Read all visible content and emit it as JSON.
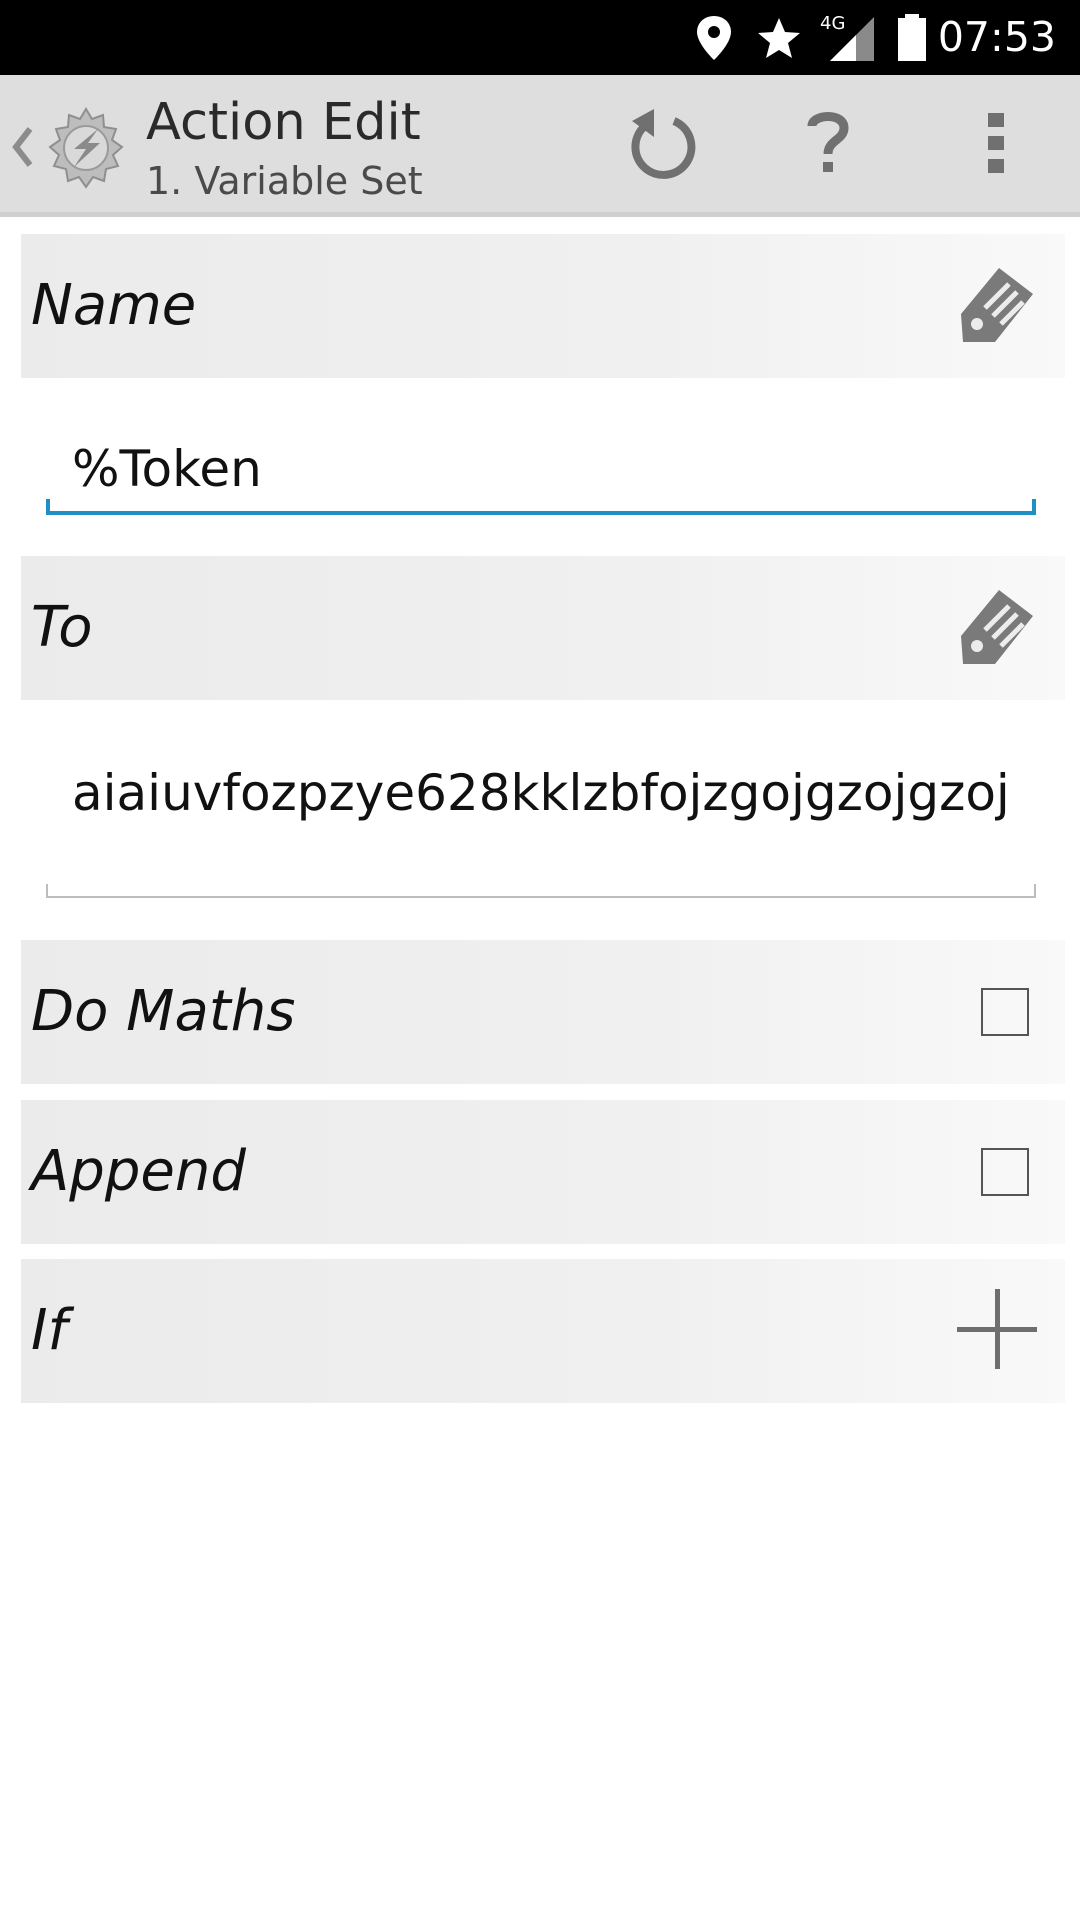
{
  "status_bar": {
    "network": "4G",
    "time": "07:53",
    "icons": [
      "location-icon",
      "star-icon",
      "signal-icon",
      "battery-icon"
    ]
  },
  "action_bar": {
    "title": "Action Edit",
    "subtitle": "1. Variable Set",
    "buttons": [
      "undo-icon",
      "help-icon",
      "overflow-menu-icon"
    ]
  },
  "params": {
    "name": {
      "label": "Name",
      "value": "%Token"
    },
    "to": {
      "label": "To",
      "value": "aiaiuvfozpzye628kklzbfojzgojgzojgzoj"
    },
    "do_maths": {
      "label": "Do Maths",
      "checked": false
    },
    "append": {
      "label": "Append",
      "checked": false
    },
    "if": {
      "label": "If"
    }
  },
  "colors": {
    "accent": "#1f8fc4",
    "action_bar": "#dedede",
    "status_bar": "#000000"
  }
}
